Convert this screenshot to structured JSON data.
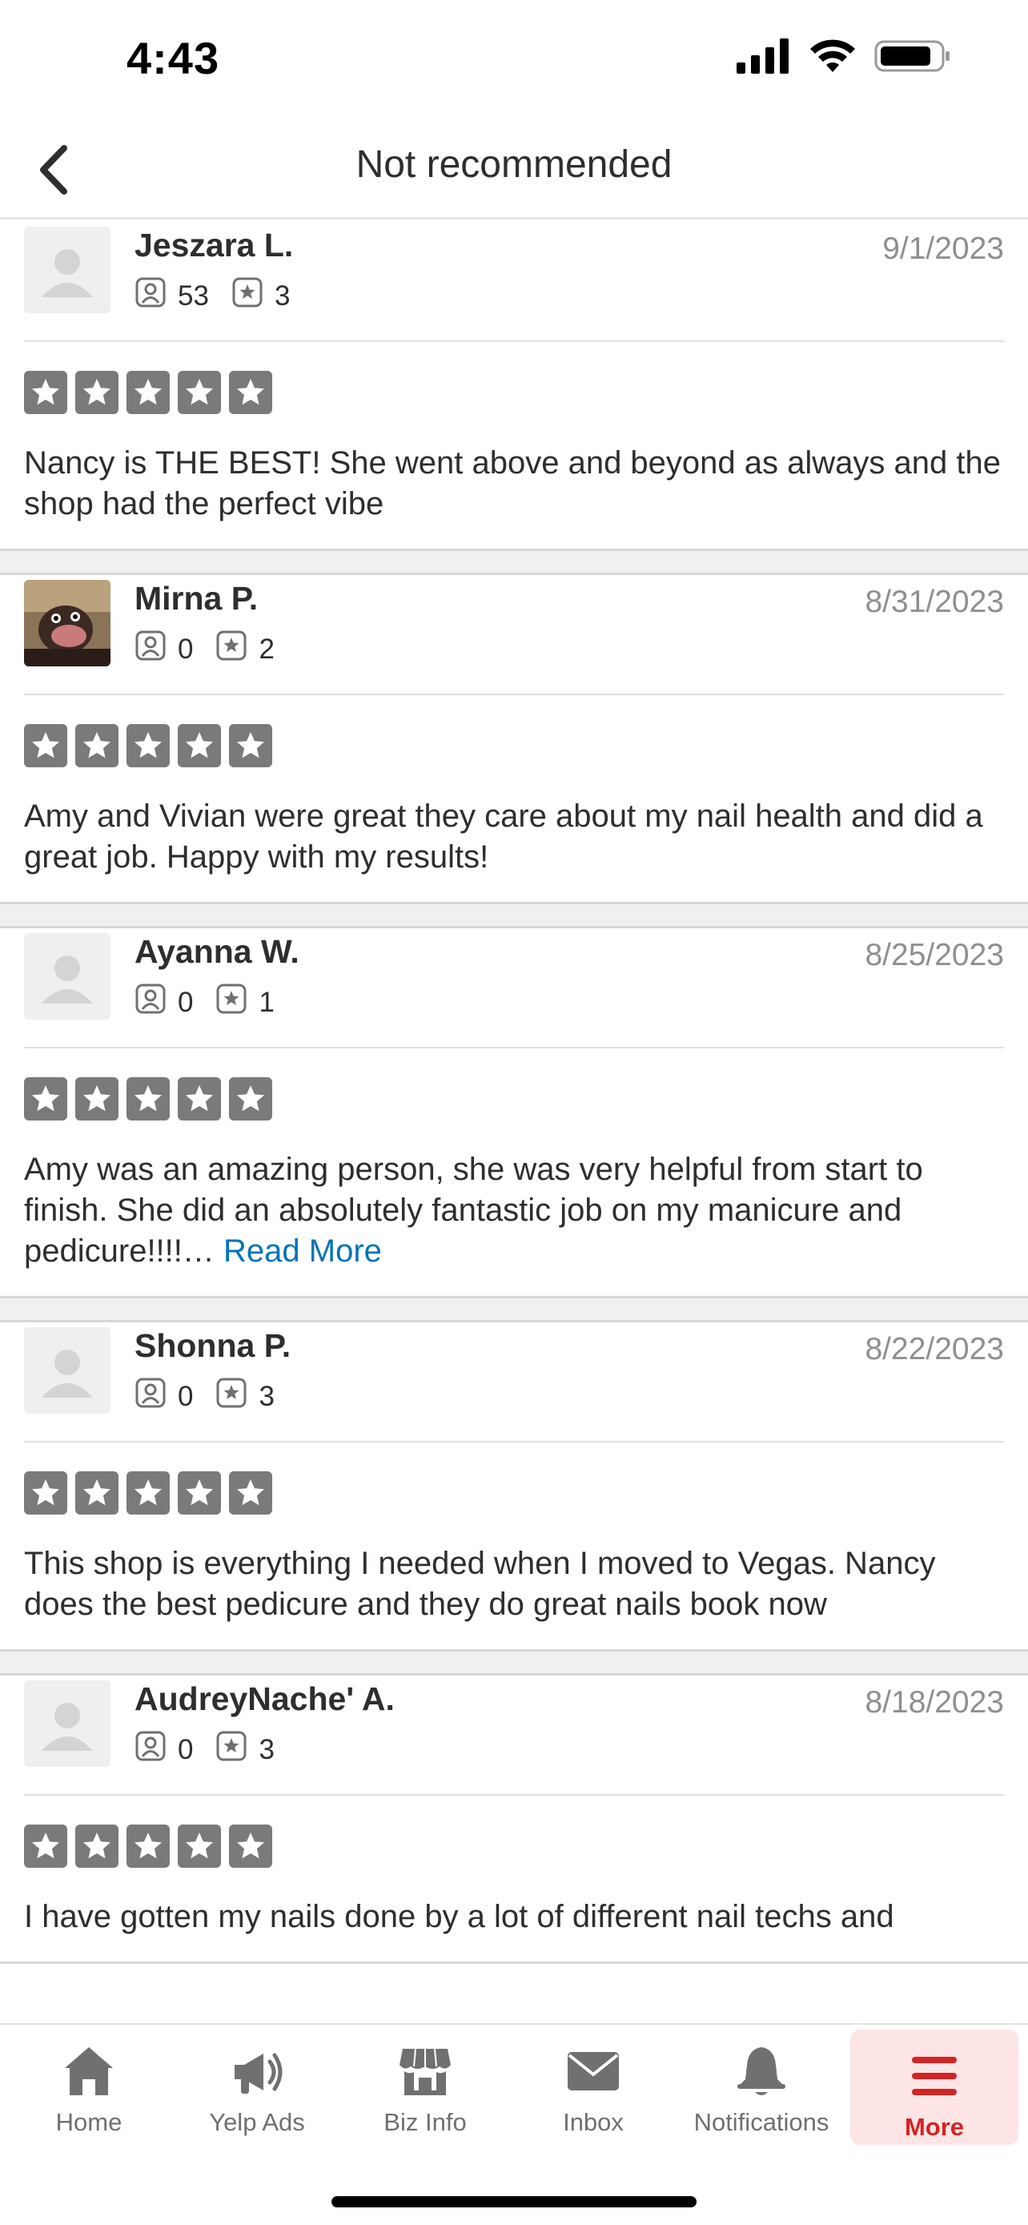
{
  "status_bar": {
    "time": "4:43"
  },
  "nav": {
    "title": "Not recommended"
  },
  "reviews": [
    {
      "name": "Jeszara L.",
      "date": "9/1/2023",
      "friends": "53",
      "reviews_count": "3",
      "rating": 5,
      "avatar": "placeholder",
      "text": "Nancy is THE BEST! She went above and beyond as always and the shop had the perfect vibe",
      "read_more": ""
    },
    {
      "name": "Mirna P.",
      "date": "8/31/2023",
      "friends": "0",
      "reviews_count": "2",
      "rating": 5,
      "avatar": "photo",
      "text": "Amy and Vivian were great they care about my nail health and did a great job. Happy with my results!",
      "read_more": ""
    },
    {
      "name": "Ayanna W.",
      "date": "8/25/2023",
      "friends": "0",
      "reviews_count": "1",
      "rating": 5,
      "avatar": "placeholder",
      "text": "Amy was an amazing person, she was very helpful from start to finish. She did an absolutely fantastic job on my manicure and pedicure!!!!… ",
      "read_more": "Read More"
    },
    {
      "name": "Shonna P.",
      "date": "8/22/2023",
      "friends": "0",
      "reviews_count": "3",
      "rating": 5,
      "avatar": "placeholder",
      "text": "This shop is everything I needed when I moved to Vegas. Nancy does the best pedicure and they do great nails book now",
      "read_more": ""
    },
    {
      "name": "AudreyNache' A.",
      "date": "8/18/2023",
      "friends": "0",
      "reviews_count": "3",
      "rating": 5,
      "avatar": "placeholder",
      "text": "I have gotten my nails done by a lot of different nail techs and",
      "read_more": ""
    }
  ],
  "tabs": [
    {
      "label": "Home",
      "icon": "home-icon",
      "active": false
    },
    {
      "label": "Yelp Ads",
      "icon": "megaphone-icon",
      "active": false
    },
    {
      "label": "Biz Info",
      "icon": "storefront-icon",
      "active": false
    },
    {
      "label": "Inbox",
      "icon": "envelope-icon",
      "active": false
    },
    {
      "label": "Notifications",
      "icon": "bell-icon",
      "active": false
    },
    {
      "label": "More",
      "icon": "hamburger-icon",
      "active": true
    }
  ],
  "colors": {
    "accent": "#d32323",
    "link": "#0073bb",
    "star": "#7a7a7a",
    "date": "#8d8f91"
  }
}
